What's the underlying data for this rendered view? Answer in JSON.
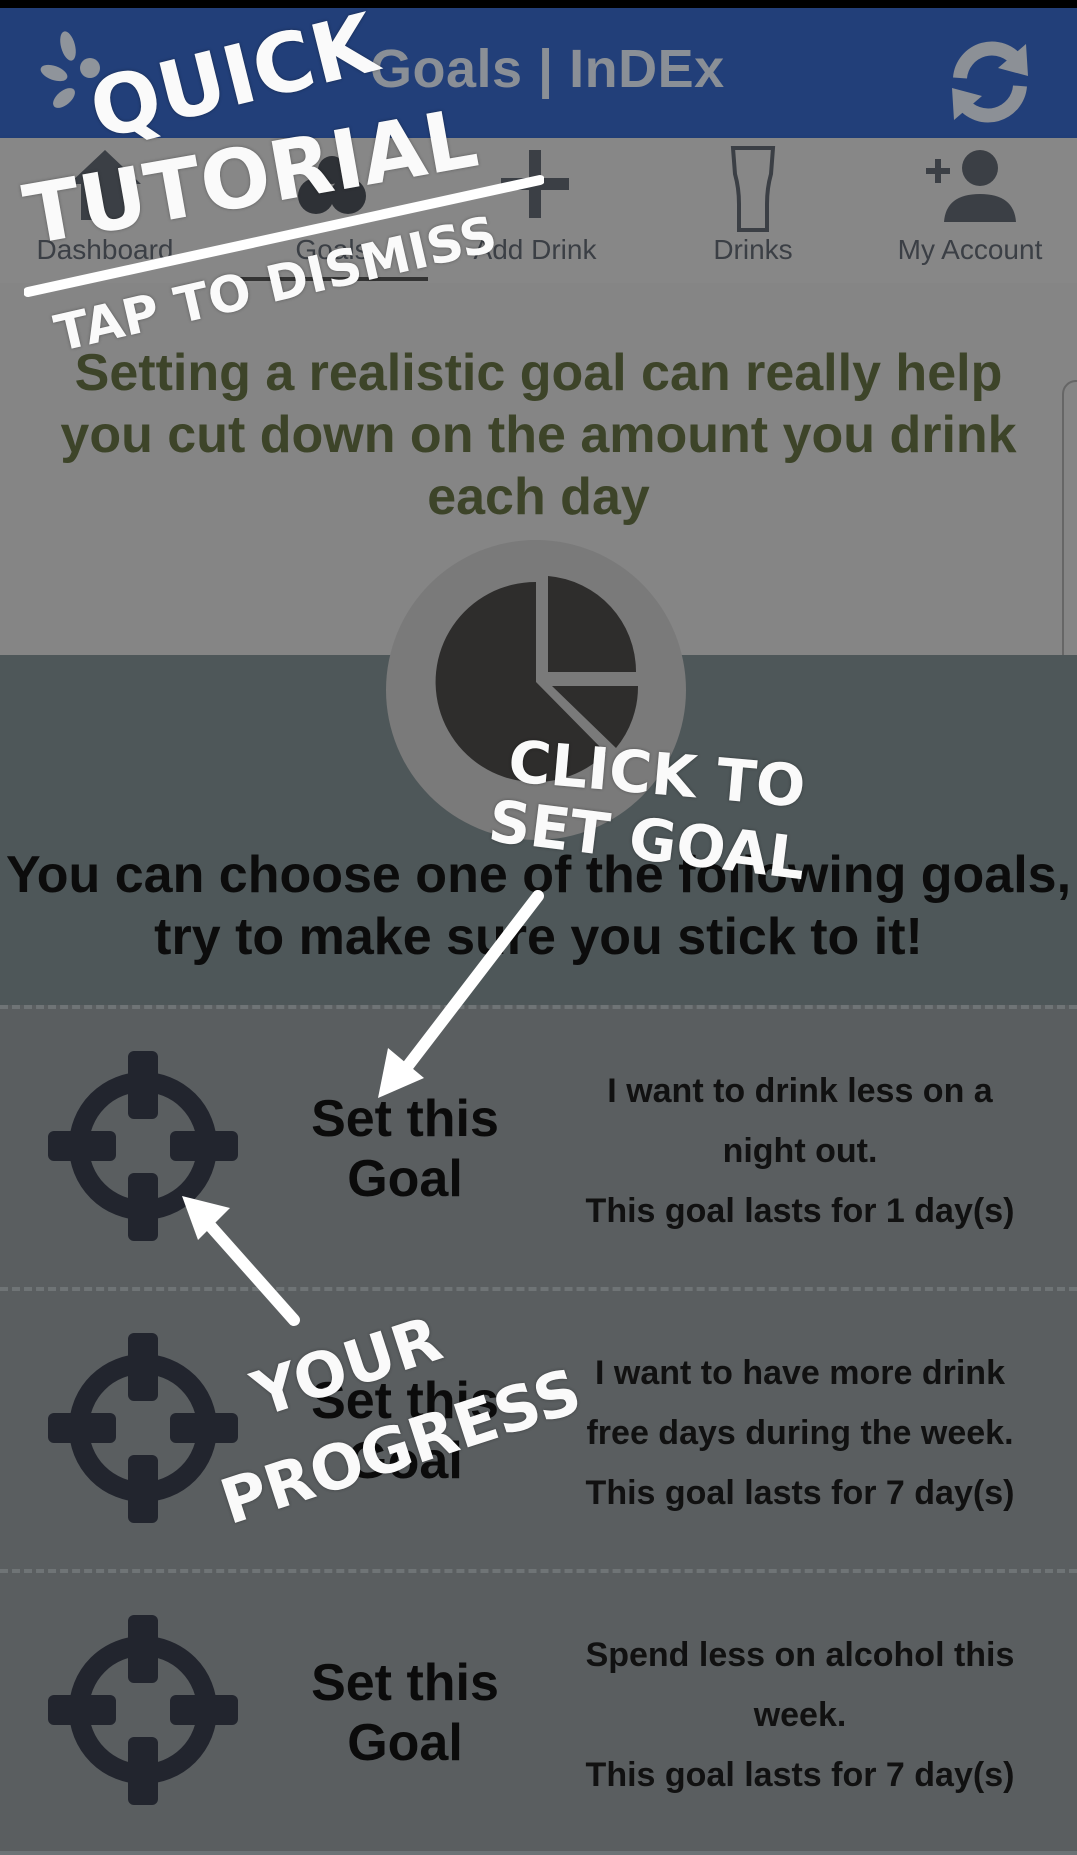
{
  "header": {
    "title": "Goals | InDEx"
  },
  "nav": {
    "items": [
      {
        "label": "Dashboard"
      },
      {
        "label": "Goals"
      },
      {
        "label": "Add Drink"
      },
      {
        "label": "Drinks"
      },
      {
        "label": "My Account"
      }
    ],
    "active": "Goals"
  },
  "main": {
    "intro": "Setting a realistic goal can really help you cut down on the amount you drink each day",
    "choose_line1": "You can choose one of the following goals,",
    "choose_line2": "try to make sure you stick to it!",
    "goals": [
      {
        "button_line1": "Set this",
        "button_line2": "Goal",
        "desc_line1": "I want to drink less on a",
        "desc_line2": "night out.",
        "duration": "This goal lasts for 1 day(s)"
      },
      {
        "button_line1": "Set this",
        "button_line2": "Goal",
        "desc_line1": "I want to have more drink",
        "desc_line2": "free days during the week.",
        "duration": "This goal lasts for 7 day(s)"
      },
      {
        "button_line1": "Set this",
        "button_line2": "Goal",
        "desc_line1": "Spend less on alcohol this",
        "desc_line2": "week.",
        "duration": "This goal lasts for 7 day(s)"
      }
    ]
  },
  "tutorial": {
    "title_line1": "QUICK",
    "title_line2": "TUTORIAL",
    "dismiss": "TAP TO DISMISS",
    "hint_set_goal_line1": "CLICK TO",
    "hint_set_goal_line2": "SET GOAL",
    "hint_progress_line1": "YOUR",
    "hint_progress_line2": "PROGRESS"
  },
  "colors": {
    "appbar": "#223f79",
    "intro_text": "#3d4429",
    "overlay_text": "#ffffff"
  }
}
